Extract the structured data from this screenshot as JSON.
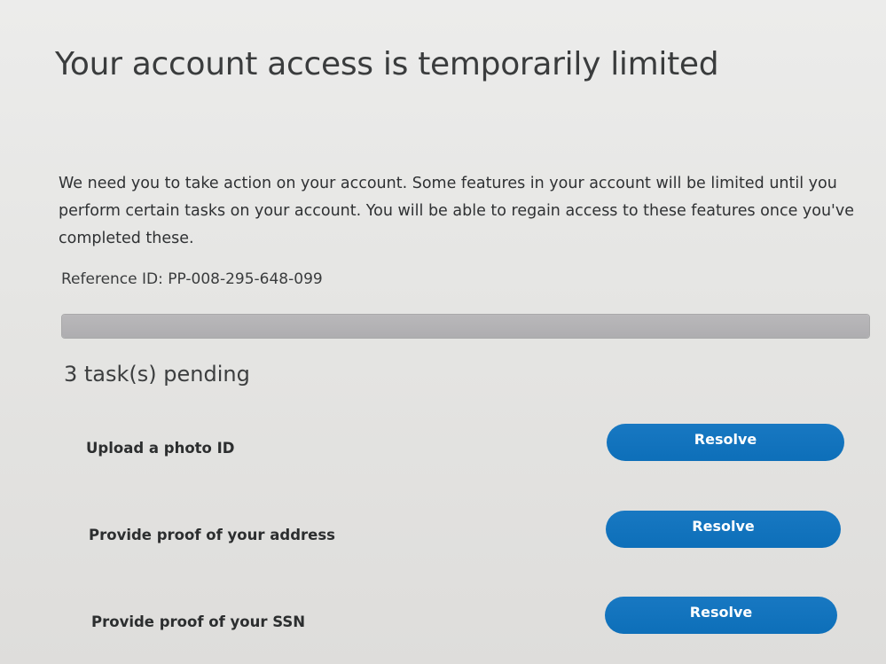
{
  "header": {
    "title": "Your account access is temporarily limited"
  },
  "notice": {
    "description": "We need you to take action on your account. Some features in your account will be limited until you perform certain tasks on your account. You will be able to regain access to these features once you've completed these.",
    "reference_id": "Reference ID: PP-008-295-648-099"
  },
  "progress": {
    "value_percent": 100
  },
  "tasks": {
    "heading": "3 task(s) pending",
    "items": [
      {
        "label": "Upload a photo ID",
        "button_label": "Resolve"
      },
      {
        "label": "Provide proof of your address",
        "button_label": "Resolve"
      },
      {
        "label": "Provide proof of your SSN",
        "button_label": "Resolve"
      }
    ]
  },
  "colors": {
    "button_blue": "#0d6fb9",
    "progress_fill": "#b0afb1",
    "background": "#e6e6e4"
  }
}
